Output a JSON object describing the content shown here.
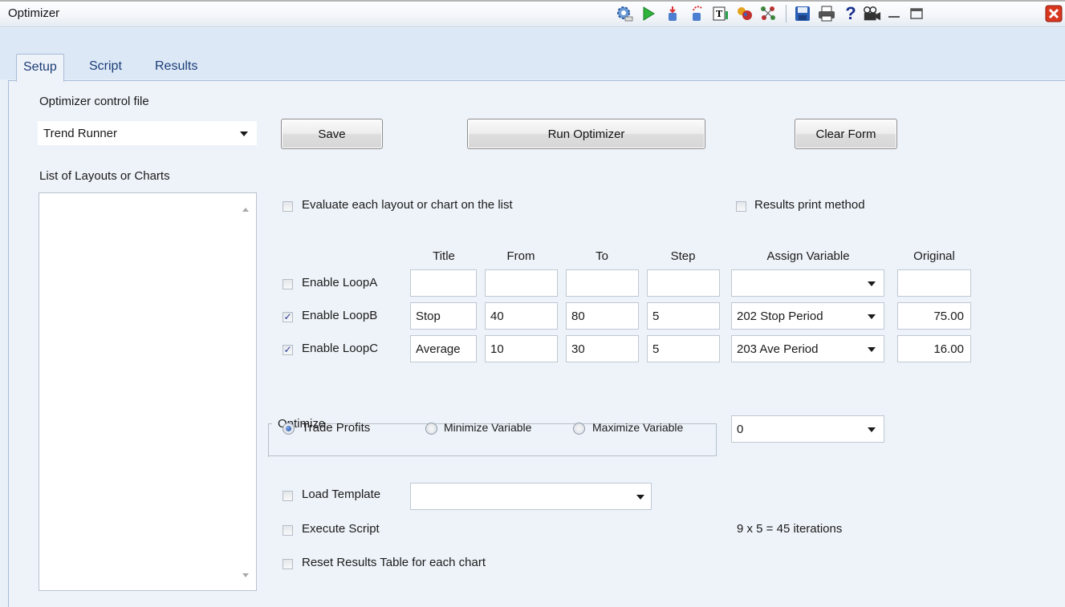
{
  "window": {
    "title": "Optimizer",
    "toolbar_icons": [
      "settings-icon",
      "play-icon",
      "import-icon",
      "export-icon",
      "text-icon",
      "bug-icon",
      "graph-icon",
      "save-icon",
      "print-icon",
      "help-icon",
      "camera-icon",
      "minimize-icon",
      "maximize-icon",
      "close-icon"
    ]
  },
  "tabs": [
    {
      "label": "Setup",
      "active": true
    },
    {
      "label": "Script",
      "active": false
    },
    {
      "label": "Results",
      "active": false
    }
  ],
  "control_file": {
    "label": "Optimizer control file",
    "value": "Trend Runner"
  },
  "buttons": {
    "save": "Save",
    "run": "Run Optimizer",
    "clear": "Clear Form"
  },
  "list": {
    "label": "List of Layouts or Charts"
  },
  "options": {
    "evaluate_each": {
      "label": "Evaluate each layout or chart on the list",
      "checked": false
    },
    "results_print": {
      "label": "Results print method",
      "checked": false
    }
  },
  "loop_table": {
    "headers": {
      "title": "Title",
      "from": "From",
      "to": "To",
      "step": "Step",
      "assign": "Assign Variable",
      "original": "Original"
    },
    "rows": [
      {
        "label": "Enable LoopA",
        "checked": false,
        "title": "",
        "from": "",
        "to": "",
        "step": "",
        "assign": "",
        "original": ""
      },
      {
        "label": "Enable LoopB",
        "checked": true,
        "title": "Stop",
        "from": "40",
        "to": "80",
        "step": "5",
        "assign": "202 Stop Period",
        "original": "75.00"
      },
      {
        "label": "Enable LoopC",
        "checked": true,
        "title": "Average",
        "from": "10",
        "to": "30",
        "step": "5",
        "assign": "203 Ave Period",
        "original": "16.00"
      }
    ]
  },
  "optimize": {
    "label": "Optimize",
    "trade_profits": "Trade Profits",
    "minimize": "Minimize Variable",
    "maximize": "Maximize Variable",
    "selected": "trade_profits",
    "variable_value": "0"
  },
  "bottom": {
    "load_template": {
      "label": "Load Template",
      "checked": false,
      "value": ""
    },
    "execute_script": {
      "label": "Execute Script",
      "checked": false
    },
    "reset_results": {
      "label": "Reset Results Table for each chart",
      "checked": false
    },
    "iterations": "9 x 5 = 45 iterations"
  },
  "colors": {
    "accent": "#1c3d77",
    "panel": "#eef3f9",
    "close": "#d9361e"
  }
}
